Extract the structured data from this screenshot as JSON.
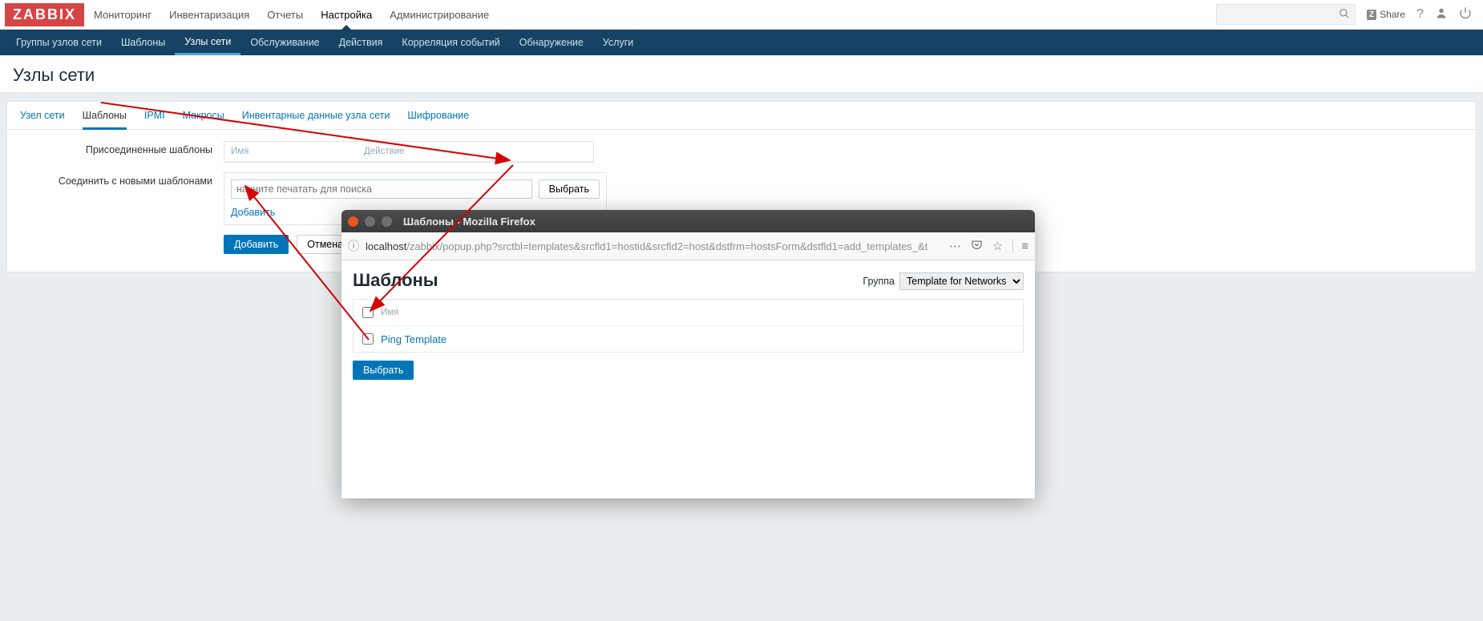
{
  "topnav": {
    "logo": "ZABBIX",
    "items": [
      "Мониторинг",
      "Инвентаризация",
      "Отчеты",
      "Настройка",
      "Администрирование"
    ],
    "active_index": 3,
    "share": "Share"
  },
  "subnav": {
    "items": [
      "Группы узлов сети",
      "Шаблоны",
      "Узлы сети",
      "Обслуживание",
      "Действия",
      "Корреляция событий",
      "Обнаружение",
      "Услуги"
    ],
    "active_index": 2
  },
  "page_title": "Узлы сети",
  "tabs": {
    "items": [
      "Узел сети",
      "Шаблоны",
      "IPMI",
      "Макросы",
      "Инвентарные данные узла сети",
      "Шифрование"
    ],
    "active_index": 1
  },
  "form": {
    "attached_templates_label": "Присоединенные шаблоны",
    "col_name": "Имя",
    "col_action": "Действие",
    "link_new_templates_label": "Соединить с новыми шаблонами",
    "search_placeholder": "начните печатать для поиска",
    "select_button": "Выбрать",
    "add_link": "Добавить",
    "submit_button": "Добавить",
    "cancel_button": "Отмена"
  },
  "popup": {
    "window_title": "Шаблоны - Mozilla Firefox",
    "url_host": "localhost",
    "url_path": "/zabbix/popup.php?srctbl=templates&srcfld1=hostid&srcfld2=host&dstfrm=hostsForm&dstfld1=add_templates_&t",
    "heading": "Шаблоны",
    "group_label": "Группа",
    "group_value": "Template for Networks",
    "col_name": "Имя",
    "rows": [
      "Ping Template"
    ],
    "select_button": "Выбрать"
  }
}
